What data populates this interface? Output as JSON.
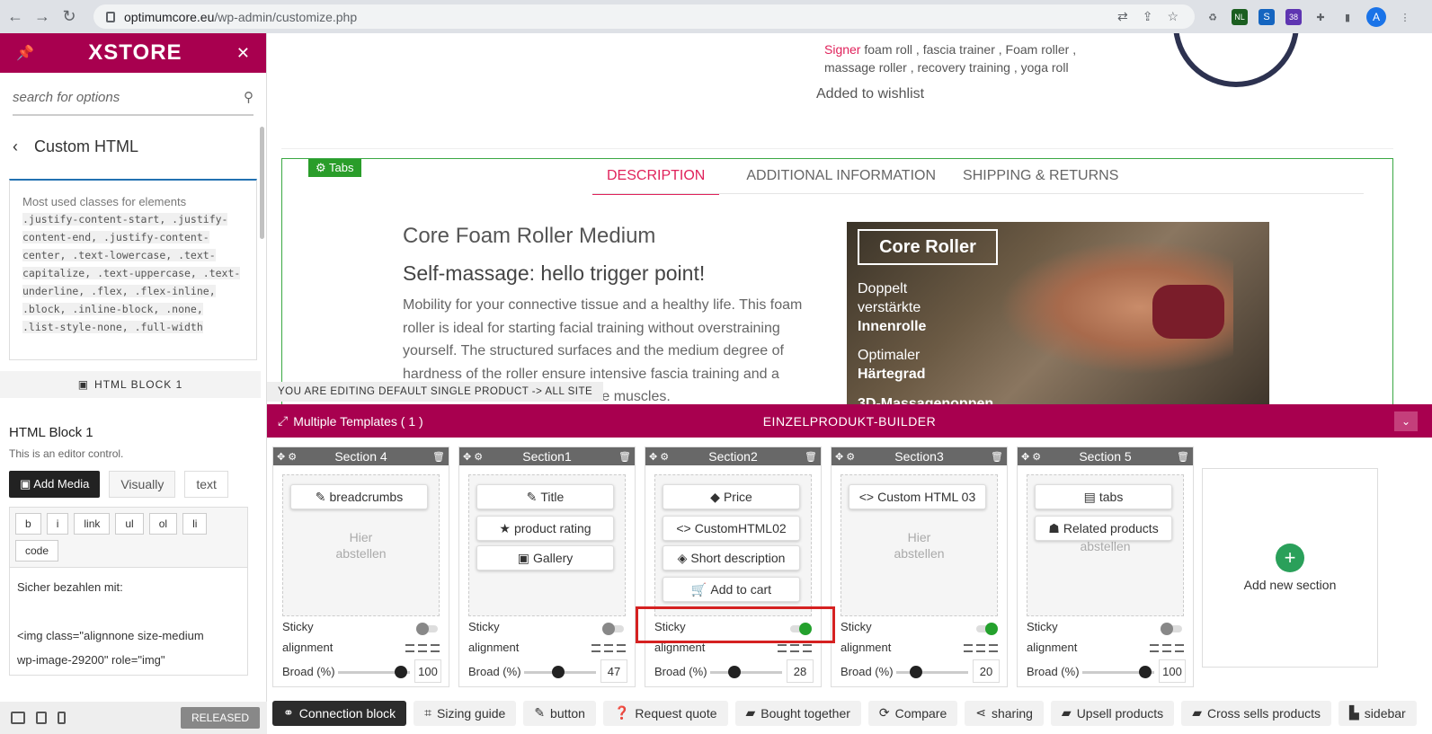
{
  "browser": {
    "url_host": "optimumcore.eu",
    "url_path": "/wp-admin/customize.php",
    "ext_badge": "38",
    "ext_nl": "NL",
    "avatar": "A"
  },
  "sidebar": {
    "logo": "XSTORE",
    "search_placeholder": "search for options",
    "back_title": "Custom HTML",
    "classes_heading": "Most used classes for elements",
    "classes_code": ".justify-content-start, .justify-content-end, .justify-content-center, .text-lowercase, .text-capitalize, .text-uppercase, .text-underline, .flex, .flex-inline, .block, .inline-block, .none, .list-style-none, .full-width",
    "section_label": "HTML BLOCK 1",
    "block_title": "HTML Block 1",
    "block_desc": "This is an editor control.",
    "add_media": "Add Media",
    "tab_visual": "Visually",
    "tab_text": "text",
    "format_buttons": [
      "b",
      "i",
      "link",
      "ul",
      "ol",
      "li",
      "code"
    ],
    "editor_line1": "Sicher bezahlen mit:",
    "editor_line2": "<img class=\"alignnone size-medium",
    "editor_line3": "wp-image-29200\" role=\"img\"",
    "released": "RELEASED"
  },
  "preview": {
    "tags_line1_a": "Signer",
    "tags_line1_b": "foam roll ,",
    "tags_line1_c": "fascia trainer ,",
    "tags_line1_d": "Foam roller ,",
    "tags_line2": "massage roller ,  recovery training ,  yoga roll",
    "wishlist": "Added to wishlist",
    "tabs_label": "Tabs",
    "tabs": [
      "DESCRIPTION",
      "ADDITIONAL INFORMATION",
      "SHIPPING & RETURNS"
    ],
    "h1": "Core Foam Roller Medium",
    "h2": "Self-massage: hello trigger point!",
    "paragraph": "Mobility for your connective tissue and a healthy life. This foam roller is ideal for starting facial training without overstraining yourself. The structured surfaces and the medium degree of hardness of the roller ensure intensive fascia training and a",
    "paragraph_tail": "the muscles.",
    "hero_title": "Core Roller",
    "hero_l1": "Doppelt",
    "hero_l2": "verstärkte",
    "hero_l3": "Innenrolle",
    "hero_l4": "Optimaler",
    "hero_l5": "Härtegrad",
    "hero_l6": "3D-Massagenoppen",
    "editing_notice": "YOU ARE EDITING DEFAULT SINGLE PRODUCT -> ALL SITE"
  },
  "builder": {
    "templates_label": "Multiple Templates ( 1 )",
    "title": "EINZELPRODUKT-BUILDER",
    "sticky_label": "Sticky",
    "alignment_label": "alignment",
    "broad_label": "Broad (%)",
    "sections": [
      {
        "name": "Section 4",
        "chips": [
          "breadcrumbs"
        ],
        "chip_icons": [
          "✎"
        ],
        "ghost": "Hier\nabstellen",
        "sticky": false,
        "broad": "100",
        "broad_fraction": 0.95
      },
      {
        "name": "Section1",
        "chips": [
          "Title",
          "product rating",
          "Gallery"
        ],
        "chip_icons": [
          "✎",
          "★",
          "▣"
        ],
        "ghost": "",
        "sticky": false,
        "broad": "47",
        "broad_fraction": 0.47
      },
      {
        "name": "Section2",
        "chips": [
          "Price",
          "CustomHTML02",
          "Short description",
          "Add to cart"
        ],
        "chip_icons": [
          "◆",
          "<>",
          "◈",
          "🛒"
        ],
        "ghost": "",
        "sticky": true,
        "broad": "28",
        "broad_fraction": 0.3
      },
      {
        "name": "Section3",
        "chips": [
          "Custom HTML 03"
        ],
        "chip_icons": [
          "<>"
        ],
        "ghost": "Hier\nabstellen",
        "sticky": true,
        "broad": "20",
        "broad_fraction": 0.22
      },
      {
        "name": "Section 5",
        "chips": [
          "tabs",
          "Related products"
        ],
        "chip_icons": [
          "▤",
          "☗"
        ],
        "ghost": "abstellen",
        "sticky": false,
        "broad": "100",
        "broad_fraction": 0.95
      }
    ],
    "add_section": "Add new section",
    "bottom_buttons": [
      "Connection block",
      "Sizing guide",
      "button",
      "Request quote",
      "Bought together",
      "Compare",
      "sharing",
      "Upsell products",
      "Cross sells products",
      "sidebar"
    ]
  }
}
